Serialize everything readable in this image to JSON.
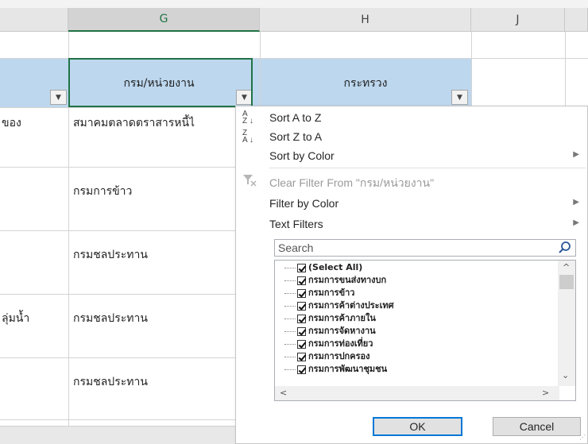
{
  "columns": {
    "g": "G",
    "h": "H",
    "j": "J"
  },
  "header_cells": {
    "g": "กรม/หน่วยงาน",
    "h": "กระทรวง"
  },
  "rows": [
    {
      "left": "ของ",
      "g": "สมาคมตลาดตราสารหนี้ไ"
    },
    {
      "left": "",
      "g": "กรมการข้าว"
    },
    {
      "left": "",
      "g": "กรมชลประทาน"
    },
    {
      "left": "ลุ่มน้ำ",
      "g": "กรมชลประทาน"
    },
    {
      "left": "",
      "g": "กรมชลประทาน"
    }
  ],
  "menu": {
    "sort_az": "Sort A to Z",
    "sort_za": "Sort Z to A",
    "sort_by_color": "Sort by Color",
    "clear_filter": "Clear Filter From \"กรม/หน่วยงาน\"",
    "filter_by_color": "Filter by Color",
    "text_filters": "Text Filters",
    "search_placeholder": "Search",
    "list_items": [
      "(Select All)",
      "กรมการขนส่งทางบก",
      "กรมการข้าว",
      "กรมการค้าต่างประเทศ",
      "กรมการค้าภายใน",
      "กรมการจัดหางาน",
      "กรมการท่องเที่ยว",
      "กรมการปกครอง",
      "กรมการพัฒนาชุมชน"
    ],
    "ok_label": "OK",
    "cancel_label": "Cancel"
  },
  "colors": {
    "header_fill": "#bdd7ee",
    "selection_border": "#217346",
    "ok_border": "#0078d7"
  }
}
